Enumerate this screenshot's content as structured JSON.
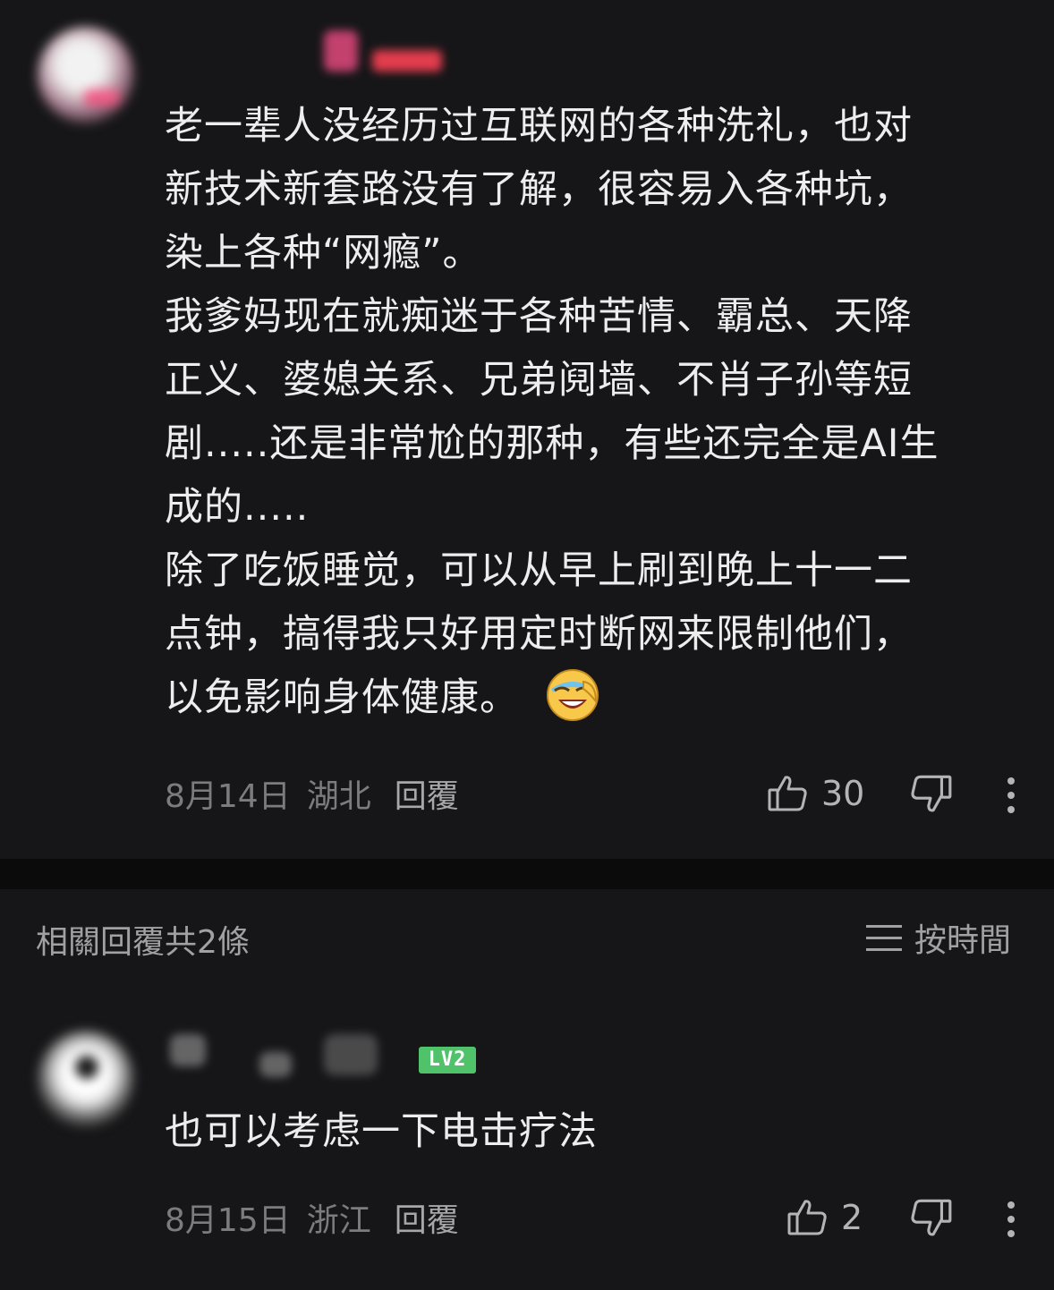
{
  "comment": {
    "badge": "",
    "text_lines": [
      "老一辈人没经历过互联网的各种洗礼，也对",
      "新技术新套路没有了解，很容易入各种坑，",
      "染上各种“网瘾”。",
      "我爹妈现在就痴迷于各种苦情、霸总、天降",
      "正义、婆媳关系、兄弟阋墙、不肖子孙等短",
      "剧.....还是非常尬的那种，有些还完全是AI生",
      "成的.....",
      "除了吃饭睡觉，可以从早上刷到晚上十一二",
      "点钟，搞得我只好用定时断网来限制他们，",
      "以免影响身体健康。"
    ],
    "emoji": "laughing-crying-emoji",
    "date": "8月14日",
    "location": "湖北",
    "reply_label": "回覆",
    "like_count": "30"
  },
  "replies_header": {
    "count_label": "相關回覆共2條",
    "sort_label": "按時間",
    "sort_icon": "list-lines-icon"
  },
  "reply": {
    "level_badge": "LV2",
    "text": "也可以考虑一下电击疗法",
    "date": "8月15日",
    "location": "浙江",
    "reply_label": "回覆",
    "like_count": "2"
  },
  "colors": {
    "background": "#161618",
    "divider": "#0b0b0c",
    "text_primary": "#ededee",
    "text_secondary": "#7c7c80",
    "level_badge": "#4fc26a"
  }
}
